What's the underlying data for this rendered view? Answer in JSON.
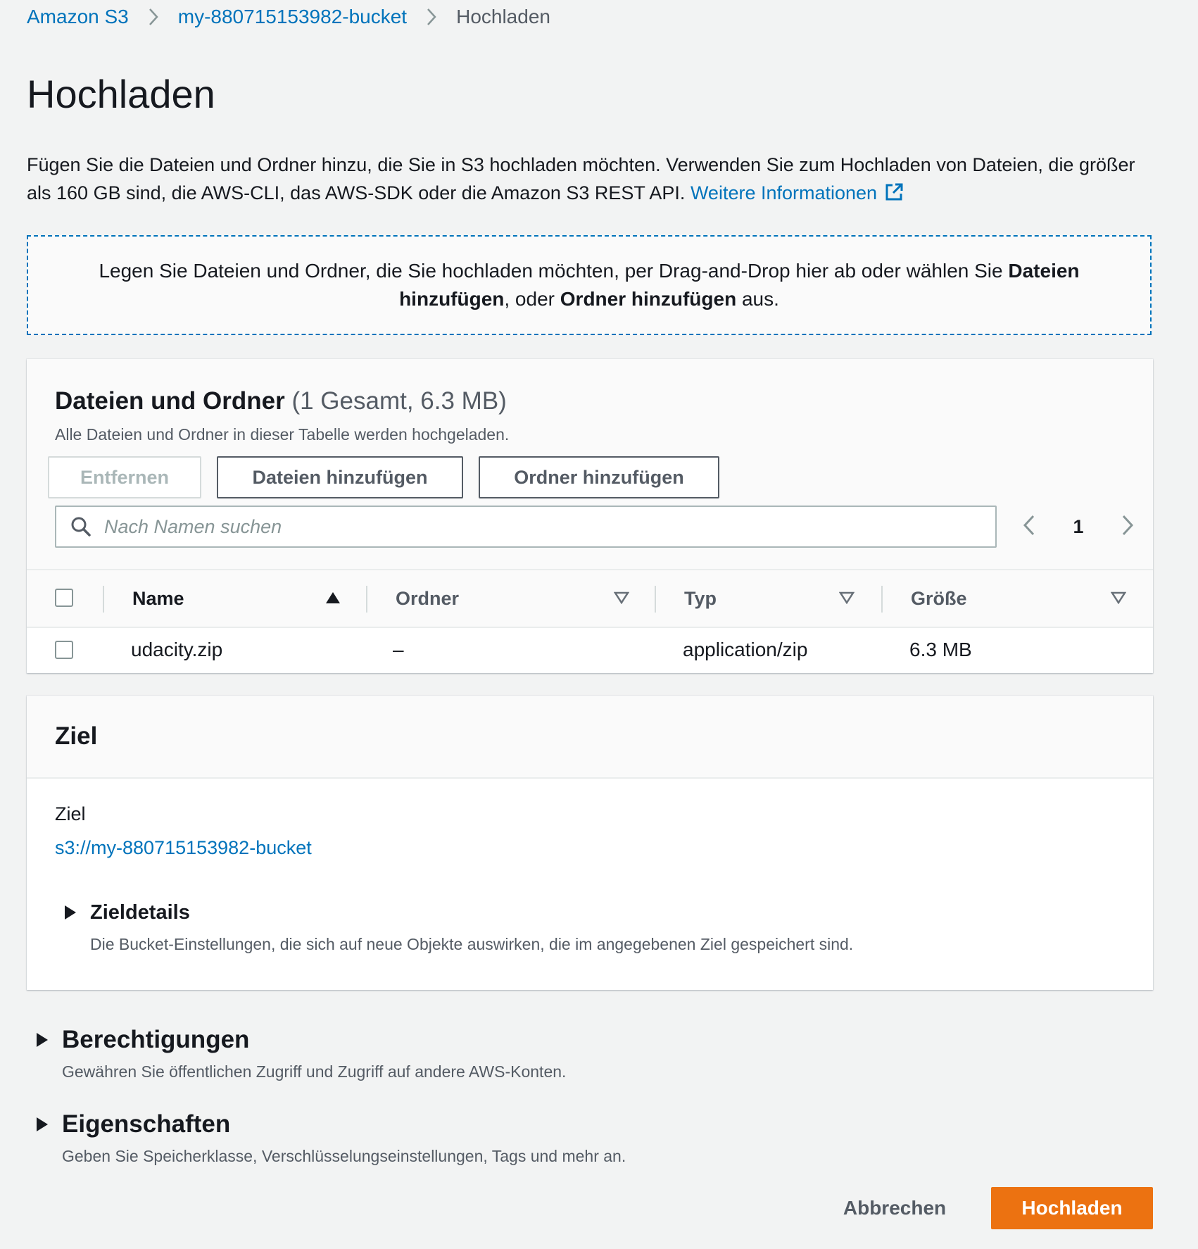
{
  "colors": {
    "link": "#0073bb",
    "primary_button": "#ec7211",
    "background": "#f2f3f3"
  },
  "breadcrumb": [
    {
      "label": "Amazon S3"
    },
    {
      "label": "my-880715153982-bucket"
    },
    {
      "label": "Hochladen"
    }
  ],
  "page_title": "Hochladen",
  "intro": {
    "text": "Fügen Sie die Dateien und Ordner hinzu, die Sie in S3 hochladen möchten. Verwenden Sie zum Hochladen von Dateien, die größer als 160 GB sind, die AWS-CLI, das AWS-SDK oder die Amazon S3 REST API. ",
    "link_label": "Weitere Informationen",
    "link_icon": "external-link-icon"
  },
  "dropzone": {
    "text1": "Legen Sie Dateien und Ordner, die Sie hochladen möchten, per Drag-and-Drop hier ab oder wählen Sie ",
    "bold1": "Dateien hinzufügen",
    "text2": ", oder ",
    "bold2": "Ordner hinzufügen",
    "text3": " aus."
  },
  "files_panel": {
    "title": "Dateien und Ordner",
    "count": "(1 Gesamt, 6.3 MB)",
    "description": "Alle Dateien und Ordner in dieser Tabelle werden hochgeladen.",
    "buttons": {
      "remove": "Entfernen",
      "add_files": "Dateien hinzufügen",
      "add_folder": "Ordner hinzufügen"
    },
    "search": {
      "placeholder": "Nach Namen suchen",
      "value": ""
    },
    "pagination": {
      "current_page": "1"
    },
    "columns": [
      "Name",
      "Ordner",
      "Typ",
      "Größe"
    ],
    "sort": {
      "column": "Name",
      "direction": "ascending"
    },
    "rows": [
      {
        "name": "udacity.zip",
        "folder": "–",
        "type": "application/zip",
        "size": "6.3 MB",
        "selected": false
      }
    ]
  },
  "target_panel": {
    "title": "Ziel",
    "label": "Ziel",
    "value": "s3://my-880715153982-bucket",
    "details_title": "Zieldetails",
    "details_desc": "Die Bucket-Einstellungen, die sich auf neue Objekte auswirken, die im angegebenen Ziel gespeichert sind."
  },
  "permissions": {
    "title": "Berechtigungen",
    "description": "Gewähren Sie öffentlichen Zugriff und Zugriff auf andere AWS-Konten."
  },
  "properties": {
    "title": "Eigenschaften",
    "description": "Geben Sie Speicherklasse, Verschlüsselungseinstellungen, Tags und mehr an."
  },
  "footer": {
    "cancel": "Abbrechen",
    "upload": "Hochladen"
  }
}
